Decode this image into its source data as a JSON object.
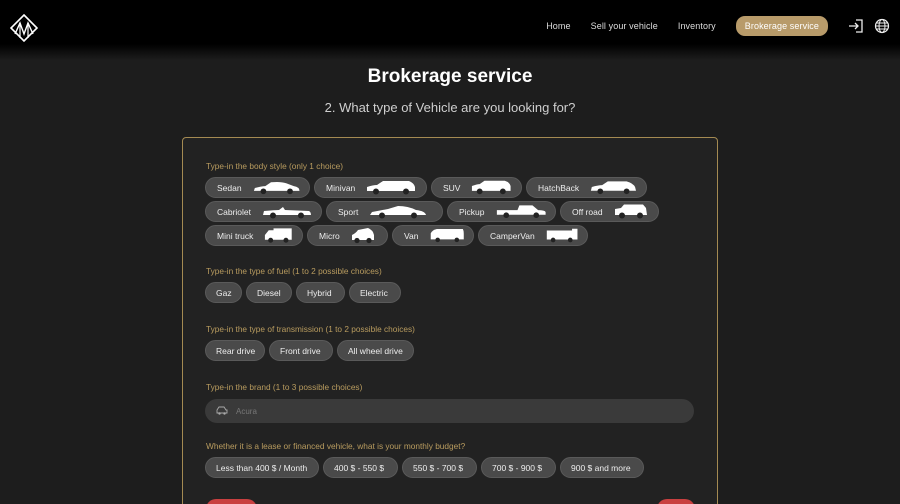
{
  "nav": {
    "links": [
      "Home",
      "Sell your vehicle",
      "Inventory"
    ],
    "active": "Brokerage service"
  },
  "page": {
    "title": "Brokerage service",
    "subtitle": "2. What type of Vehicle are you looking for?"
  },
  "form": {
    "body_label": "Type-in the body style (only 1 choice)",
    "body_styles": [
      [
        "Sedan",
        "Minivan",
        "SUV",
        "HatchBack"
      ],
      [
        "Cabriolet",
        "Sport",
        "Pickup",
        "Off road"
      ],
      [
        "Mini truck",
        "Micro",
        "Van",
        "CamperVan"
      ]
    ],
    "fuel_label": "Type-in the type of fuel (1 to 2 possible choices)",
    "fuels": [
      "Gaz",
      "Diesel",
      "Hybrid",
      "Electric"
    ],
    "transmission_label": "Type-in the type of transmission (1 to 2 possible choices)",
    "transmissions": [
      "Rear drive",
      "Front drive",
      "All wheel drive"
    ],
    "brand_label": "Type-in the brand (1 to 3 possible choices)",
    "brand_placeholder": "Acura",
    "budget_label": "Whether it is a lease or financed vehicle, what is your monthly budget?",
    "budgets": [
      "Less than 400 $ / Month",
      "400 $ - 550 $",
      "550 $ - 700 $",
      "700 $ - 900 $",
      "900 $ and more"
    ]
  },
  "colors": {
    "accent": "#b89b6a",
    "label": "#b99c5f",
    "chip": "#4a4a4a",
    "red": "#c94040"
  }
}
